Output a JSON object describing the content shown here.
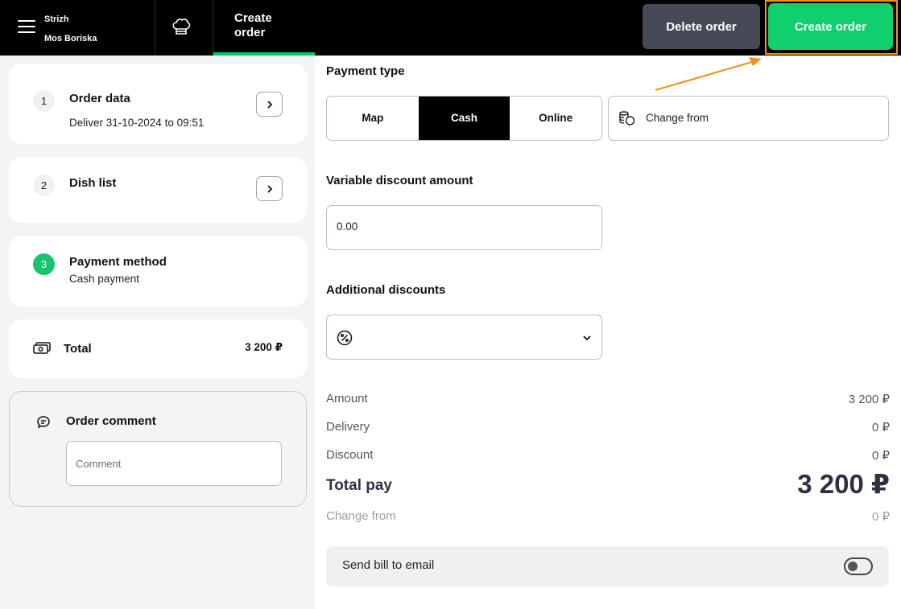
{
  "header": {
    "store_name": "Strizh",
    "store_sub": "Mos Boriska",
    "tab_create": "Create order",
    "delete_label": "Delete order",
    "create_label": "Create order"
  },
  "steps": [
    {
      "num": "1",
      "title": "Order data",
      "subtitle": "Deliver 31-10-2024 to 09:51"
    },
    {
      "num": "2",
      "title": "Dish list"
    },
    {
      "num": "3",
      "title": "Payment method",
      "subtitle": "Cash payment"
    }
  ],
  "total": {
    "label": "Total",
    "amount": "3 200 ₽"
  },
  "comment": {
    "title": "Order comment",
    "placeholder": "Comment"
  },
  "payment": {
    "title": "Payment type",
    "options": [
      "Map",
      "Cash",
      "Online"
    ],
    "selected": "Cash",
    "change_from": "Change from"
  },
  "discount": {
    "title": "Variable discount amount",
    "value": "0.00"
  },
  "additional": {
    "title": "Additional discounts"
  },
  "summary": {
    "amount_label": "Amount",
    "amount": "3 200 ₽",
    "delivery_label": "Delivery",
    "delivery": "0 ₽",
    "discount_label": "Discount",
    "discount": "0 ₽",
    "total_label": "Total pay",
    "total": "3 200 ₽",
    "change_label": "Change from",
    "change": "0 ₽"
  },
  "email": {
    "label": "Send bill to email",
    "enabled": false
  },
  "colors": {
    "accent": "#0fcf6e",
    "highlight": "#f5901e",
    "header_bg": "#000000",
    "delete_bg": "#464a57"
  }
}
